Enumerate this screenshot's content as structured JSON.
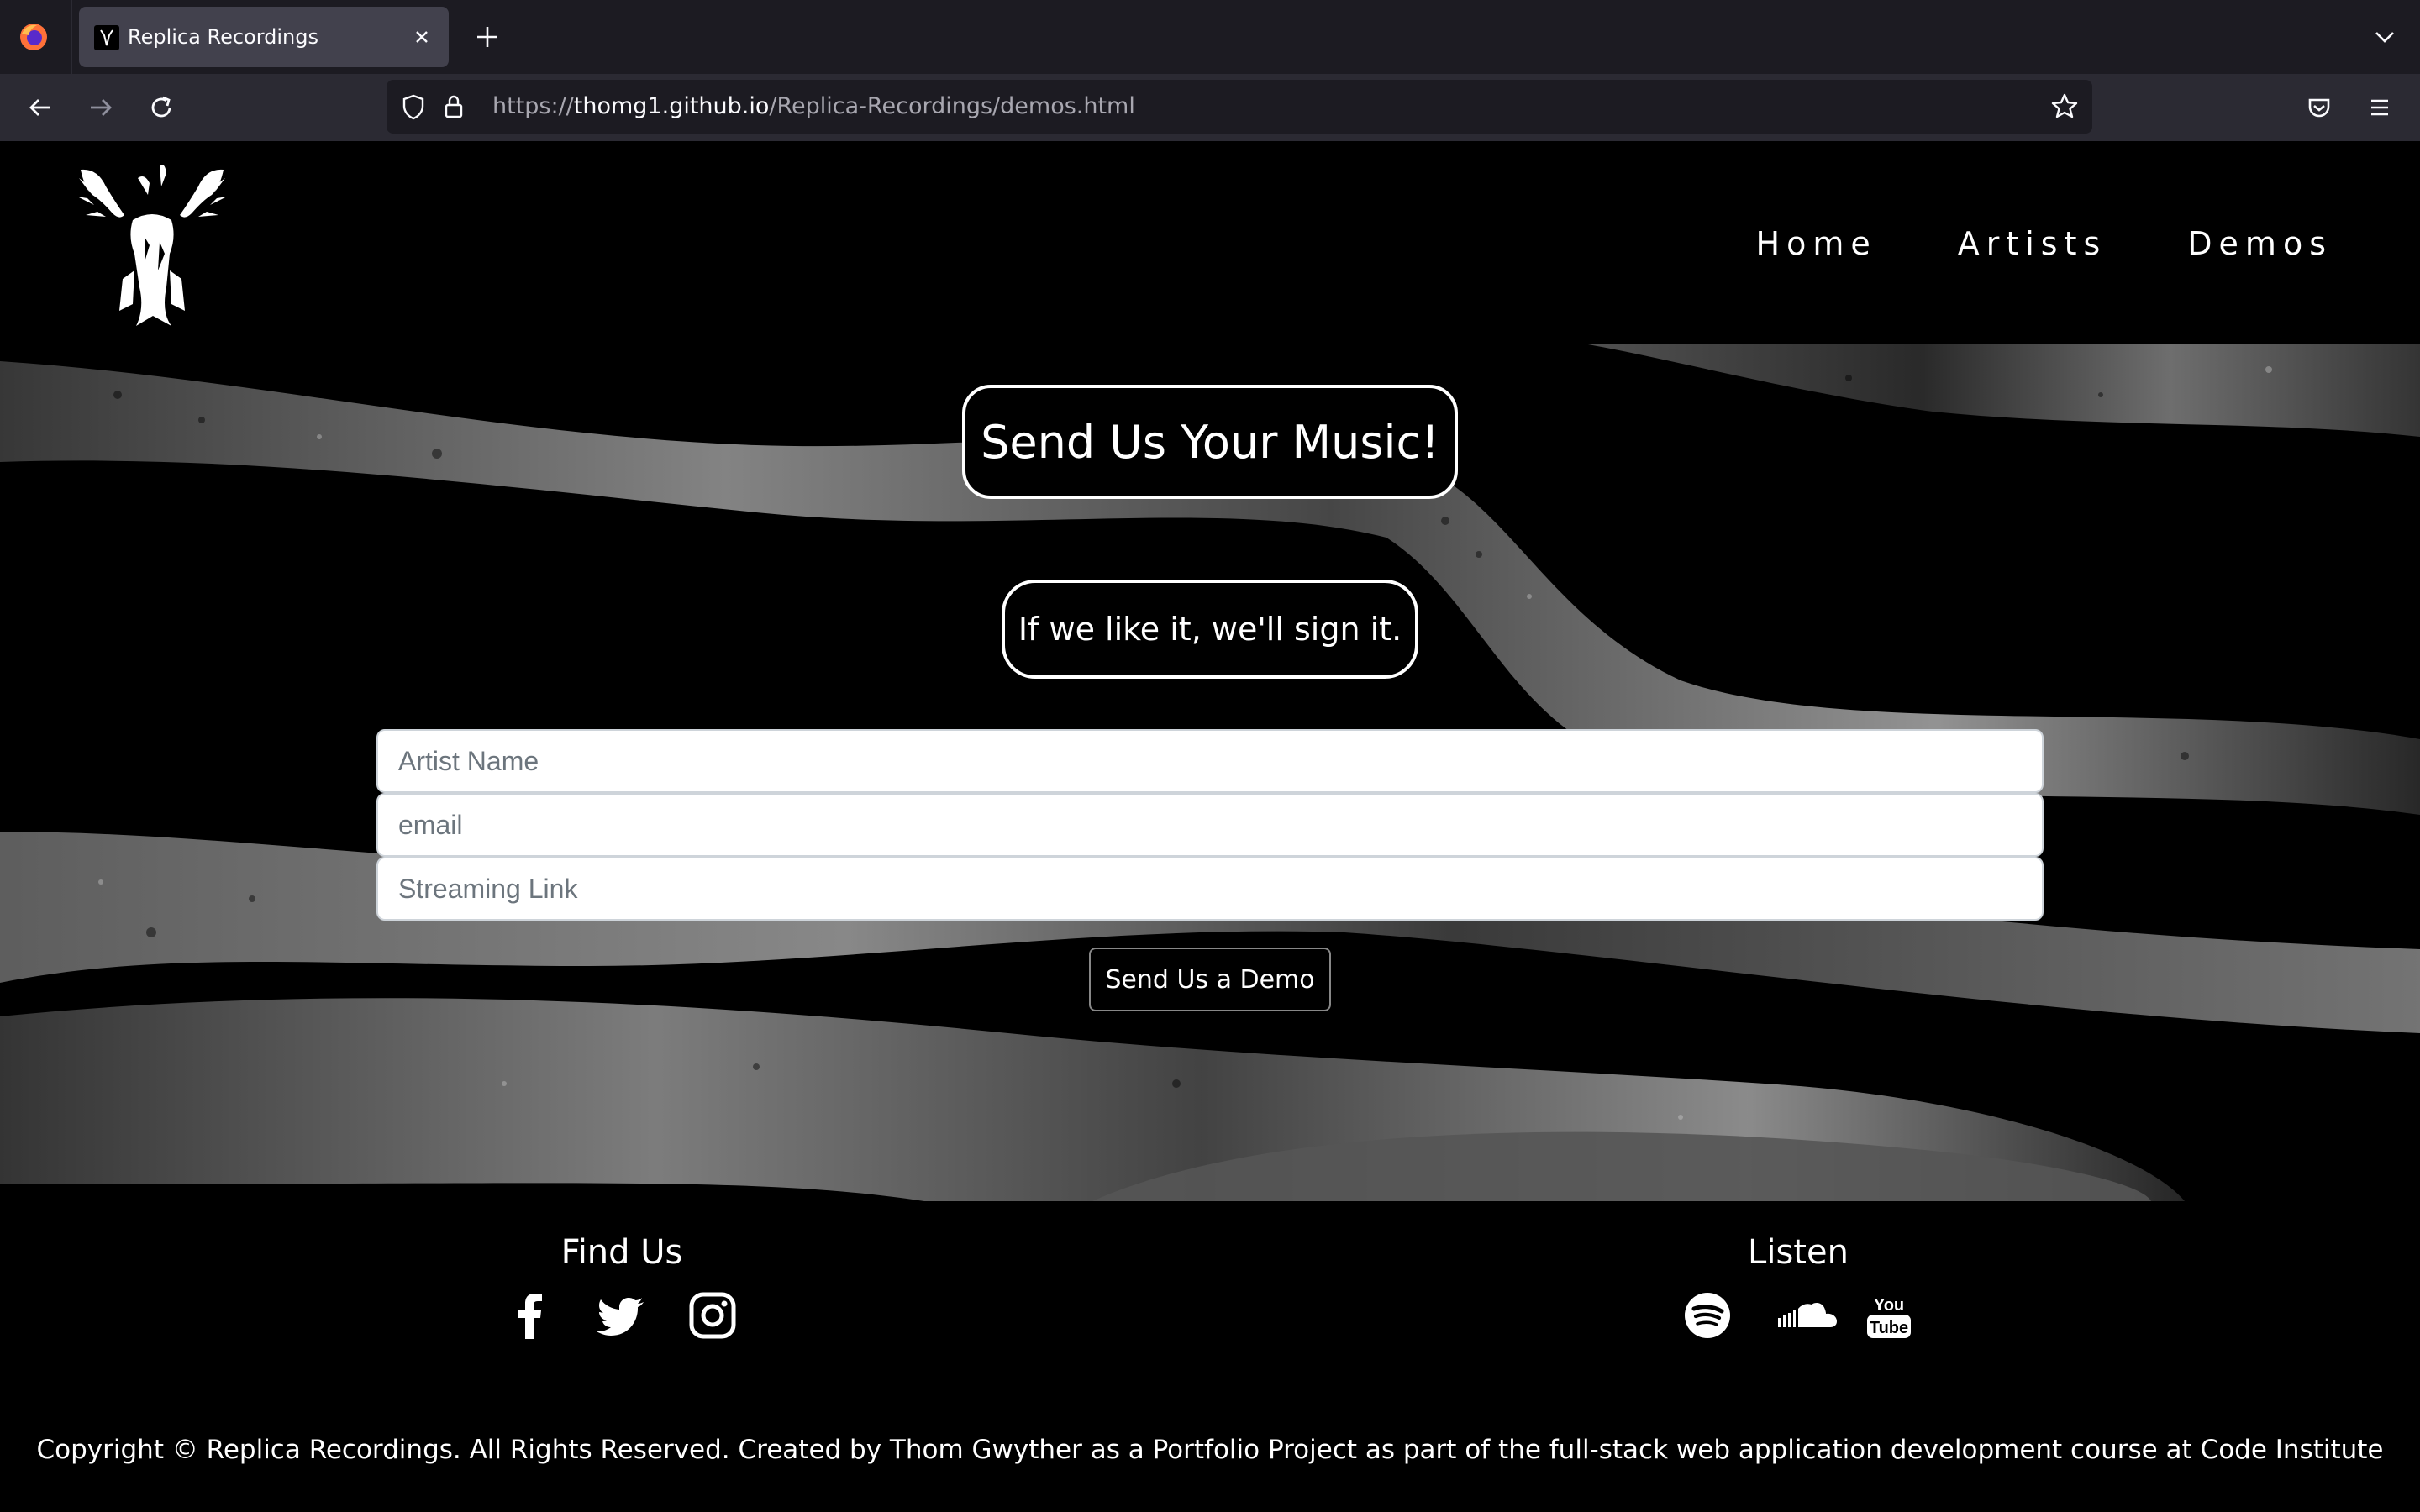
{
  "browser": {
    "tab_title": "Replica Recordings",
    "url_prefix": "https://",
    "url_host": "thomg1.github.io",
    "url_path": "/Replica-Recordings/demos.html"
  },
  "site": {
    "nav": [
      "Home",
      "Artists",
      "Demos"
    ],
    "heading": "Send Us Your Music!",
    "subheading": "If we like it, we'll sign it.",
    "form": {
      "artist_placeholder": "Artist Name",
      "email_placeholder": "email",
      "link_placeholder": "Streaming Link",
      "submit_label": "Send Us a Demo"
    },
    "footer": {
      "find_us": "Find Us",
      "find_icons": [
        "facebook-icon",
        "twitter-icon",
        "instagram-icon"
      ],
      "listen": "Listen",
      "listen_icons": [
        "spotify-icon",
        "soundcloud-icon",
        "youtube-icon"
      ],
      "copyright": "Copyright © Replica Recordings. All Rights Reserved. Created by Thom Gwyther as a Portfolio Project as part of the full-stack web application development course at Code Institute"
    }
  },
  "colors": {
    "chrome_tabbar": "#1c1b22",
    "chrome_navbar": "#2b2a33",
    "active_tab": "#42414d",
    "page_background": "#000000",
    "text": "#ffffff"
  }
}
